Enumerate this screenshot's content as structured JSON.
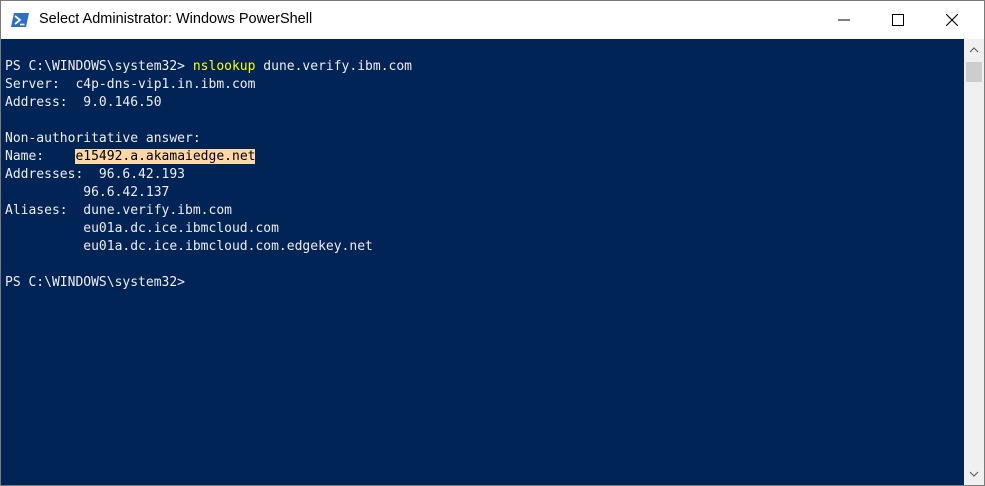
{
  "window": {
    "title": "Select Administrator: Windows PowerShell",
    "icon": "powershell-icon",
    "controls": [
      "minimize-icon",
      "maximize-icon",
      "close-icon"
    ]
  },
  "console": {
    "colors": {
      "background": "#012456",
      "text": "#eeedf0",
      "command": "#ffff00",
      "selection": "#fdd7a5"
    },
    "prompt1": "PS C:\\WINDOWS\\system32> ",
    "command_name": "nslookup",
    "command_args": " dune.verify.ibm.com",
    "server_line": "Server:  c4p-dns-vip1.in.ibm.com",
    "address_line": "Address:  9.0.146.50",
    "nonauth_line": "Non-authoritative answer:",
    "name_label": "Name:    ",
    "name_value": "e15492.a.akamaiedge.net",
    "addresses_line": "Addresses:  96.6.42.193",
    "addresses_line2": "          96.6.42.137",
    "aliases_line": "Aliases:  dune.verify.ibm.com",
    "aliases_line2": "          eu01a.dc.ice.ibmcloud.com",
    "aliases_line3": "          eu01a.dc.ice.ibmcloud.com.edgekey.net",
    "prompt2": "PS C:\\WINDOWS\\system32>"
  }
}
